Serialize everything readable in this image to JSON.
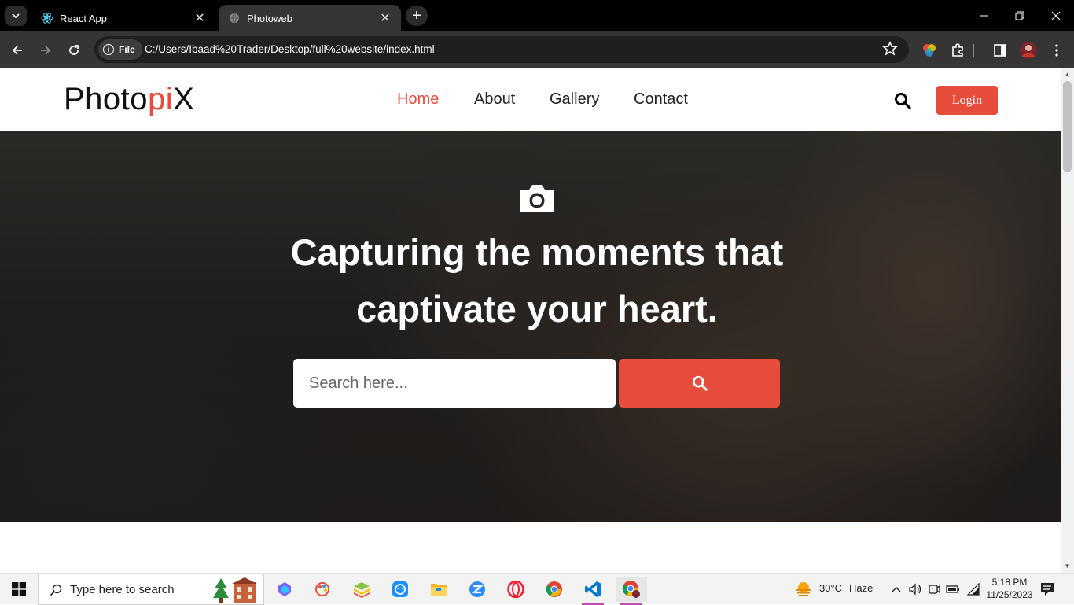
{
  "browser": {
    "tabs": [
      {
        "title": "React App",
        "active": false,
        "icon": "react-icon"
      },
      {
        "title": "Photoweb",
        "active": true,
        "icon": "globe-icon"
      }
    ],
    "new_tab_label": "+",
    "omnibox": {
      "chip_label": "File",
      "url": "C:/Users/Ibaad%20Trader/Desktop/full%20website/index.html"
    }
  },
  "site": {
    "logo": {
      "main": "Photo",
      "accent": "pi",
      "tail": "X"
    },
    "accent_color": "#e74c3c",
    "nav": [
      {
        "label": "Home",
        "active": true
      },
      {
        "label": "About",
        "active": false
      },
      {
        "label": "Gallery",
        "active": false
      },
      {
        "label": "Contact",
        "active": false
      }
    ],
    "login_label": "Login",
    "hero": {
      "headline_line1": "Capturing the moments that",
      "headline_line2": "captivate your heart.",
      "search_placeholder": "Search here..."
    }
  },
  "taskbar": {
    "search_placeholder": "Type here to search",
    "weather": {
      "temp": "30°C",
      "condition": "Haze"
    },
    "clock": {
      "time": "5:18 PM",
      "date": "11/25/2023"
    }
  }
}
